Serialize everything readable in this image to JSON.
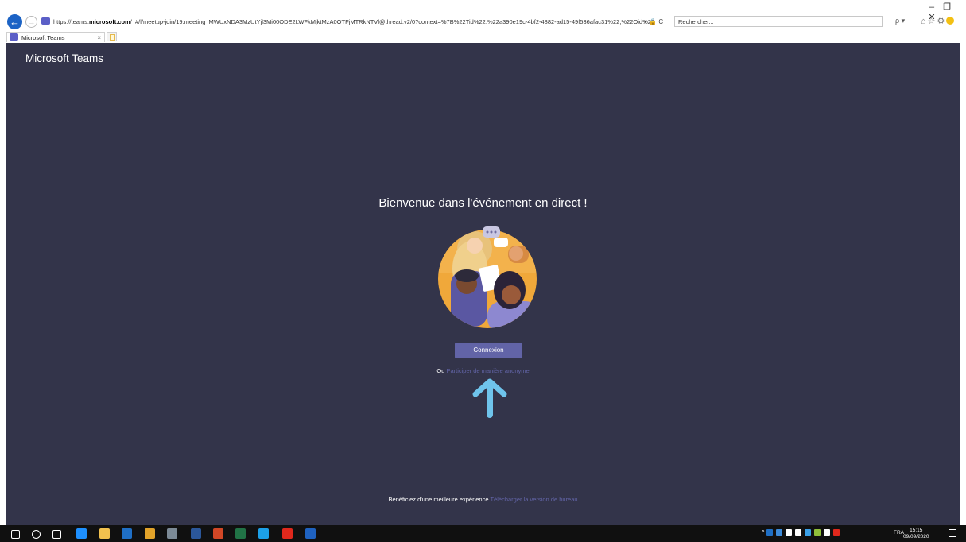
{
  "browser": {
    "url_prefix": "https://teams.",
    "url_domain": "microsoft.com",
    "url_rest": "/_#/l/meetup-join/19:meeting_MWUxNDA3MzUtYjl3Mi00ODE2LWFkMjktMzA0OTFjMTRkNTVl@thread.v2/0?context=%7B%22Tid%22:%22a390e19c-4bf2-4882-ad15-49f536afac31%22,%22Oid%22",
    "address_tools": "▾ 🔒 C",
    "search_placeholder": "Rechercher...",
    "search_dropdown": "ρ ▾",
    "tab_title": "Microsoft Teams",
    "tab_close": "×",
    "window_minimize": "–",
    "window_restore": "❐",
    "window_close": "✕"
  },
  "page": {
    "brand": "Microsoft Teams",
    "welcome_title": "Bienvenue dans l'événement en direct !",
    "signin_button": "Connexion",
    "or_text": "Ou",
    "anonymous_link": "Participer de manière anonyme",
    "footer_text": "Bénéficiez d'une meilleure expérience",
    "download_link": "Télécharger la version de bureau"
  },
  "taskbar": {
    "apps": [
      {
        "icon": "windows-start-icon",
        "color": "#ffffff"
      },
      {
        "icon": "search-icon",
        "color": "#ffffff"
      },
      {
        "icon": "task-view-icon",
        "color": "#ffffff"
      },
      {
        "icon": "edge-icon",
        "color": "#1e90ff"
      },
      {
        "icon": "file-explorer-icon",
        "color": "#f2c14e"
      },
      {
        "icon": "outlook-icon",
        "color": "#1f6fc5"
      },
      {
        "icon": "chrome-icon",
        "color": "#e2a32a"
      },
      {
        "icon": "app-icon",
        "color": "#7c8a96"
      },
      {
        "icon": "word-icon",
        "color": "#2b579a"
      },
      {
        "icon": "powerpoint-icon",
        "color": "#d24726"
      },
      {
        "icon": "excel-icon",
        "color": "#217346"
      },
      {
        "icon": "internet-explorer-icon",
        "color": "#1ca0e8"
      },
      {
        "icon": "acrobat-icon",
        "color": "#e0281c"
      },
      {
        "icon": "security-app-icon",
        "color": "#1f62c0"
      }
    ],
    "tray_caret": "^",
    "language": "FRA",
    "time": "15:15",
    "date": "09/09/2020"
  },
  "colors": {
    "teams_bg": "#33344a",
    "accent": "#6264a7",
    "annotation_arrow": "#6fc4ec"
  }
}
